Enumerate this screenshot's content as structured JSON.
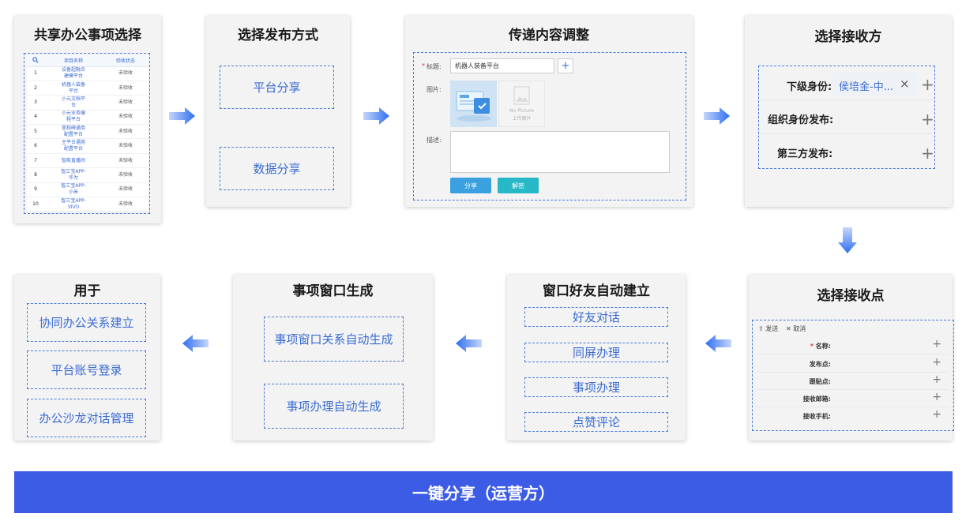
{
  "cards": {
    "share_select": {
      "title": "共享办公事项选择",
      "table": {
        "headers": [
          "项目名称",
          "验收状态"
        ],
        "rows": [
          {
            "id": "1",
            "name": "设备超融合\n建模平台",
            "status": "未验收"
          },
          {
            "id": "2",
            "name": "机器人装备\n平台",
            "status": "未验收"
          },
          {
            "id": "3",
            "name": "小元文档平\n台",
            "status": "未验收"
          },
          {
            "id": "4",
            "name": "小元业务编\n程平台",
            "status": "未验收"
          },
          {
            "id": "5",
            "name": "里程碑通用\n配置平台",
            "status": "未验收"
          },
          {
            "id": "6",
            "name": "主平台通用\n配置平台",
            "status": "未验收"
          },
          {
            "id": "7",
            "name": "智能直播间",
            "status": "未验收"
          },
          {
            "id": "8",
            "name": "智三宝APP-\n华为",
            "status": "未验收"
          },
          {
            "id": "9",
            "name": "智三宝APP-\n小米",
            "status": "未验收"
          },
          {
            "id": "10",
            "name": "智三宝APP-\nVIVO",
            "status": "未验收"
          }
        ]
      }
    },
    "publish_method": {
      "title": "选择发布方式",
      "options": [
        "平台分享",
        "数据分享"
      ]
    },
    "content_adjust": {
      "title": "传递内容调整",
      "required_mark": "*",
      "title_label": "标题:",
      "title_value": "机器人装备平台",
      "image_label": "图片:",
      "no_picture": "No Picture",
      "upload_label": "上传图片",
      "desc_label": "描述:",
      "share_button": "分享",
      "cancel_button": "解密"
    },
    "receiver": {
      "title": "选择接收方",
      "rows": [
        {
          "label": "下级身份:",
          "tag": "侯培金-中...",
          "close": "×"
        },
        {
          "label": "组织身份发布:"
        },
        {
          "label": "第三方发布:"
        }
      ]
    },
    "receive_point": {
      "title": "选择接收点",
      "send_label": "发送",
      "cancel_label": "取消",
      "rows": [
        {
          "label": "名称:",
          "required": "*"
        },
        {
          "label": "发布点:"
        },
        {
          "label": "跟贴点:"
        },
        {
          "label": "接收邮箱:"
        },
        {
          "label": "接收手机:"
        }
      ]
    },
    "auto_friend": {
      "title": "窗口好友自动建立",
      "options": [
        "好友对话",
        "同屏办理",
        "事项办理",
        "点赞评论"
      ]
    },
    "window_gen": {
      "title": "事项窗口生成",
      "options": [
        "事项窗口关系自动生成",
        "事项办理自动生成"
      ]
    },
    "used_for": {
      "title": "用于",
      "options": [
        "协同办公关系建立",
        "平台账号登录",
        "办公沙龙对话管理"
      ]
    }
  },
  "banner": "一键分享（运营方）",
  "colors": {
    "accent": "#3d5ce6",
    "dash": "#4a7cd8",
    "option_text": "#3a6bd0",
    "share_button": "#3aa0e0",
    "cancel_button": "#27b8c8"
  },
  "icons": [
    "search-icon",
    "plus-icon",
    "close-icon",
    "share-icon",
    "image-placeholder-icon",
    "arrow-right-icon",
    "arrow-down-icon",
    "arrow-left-icon"
  ]
}
